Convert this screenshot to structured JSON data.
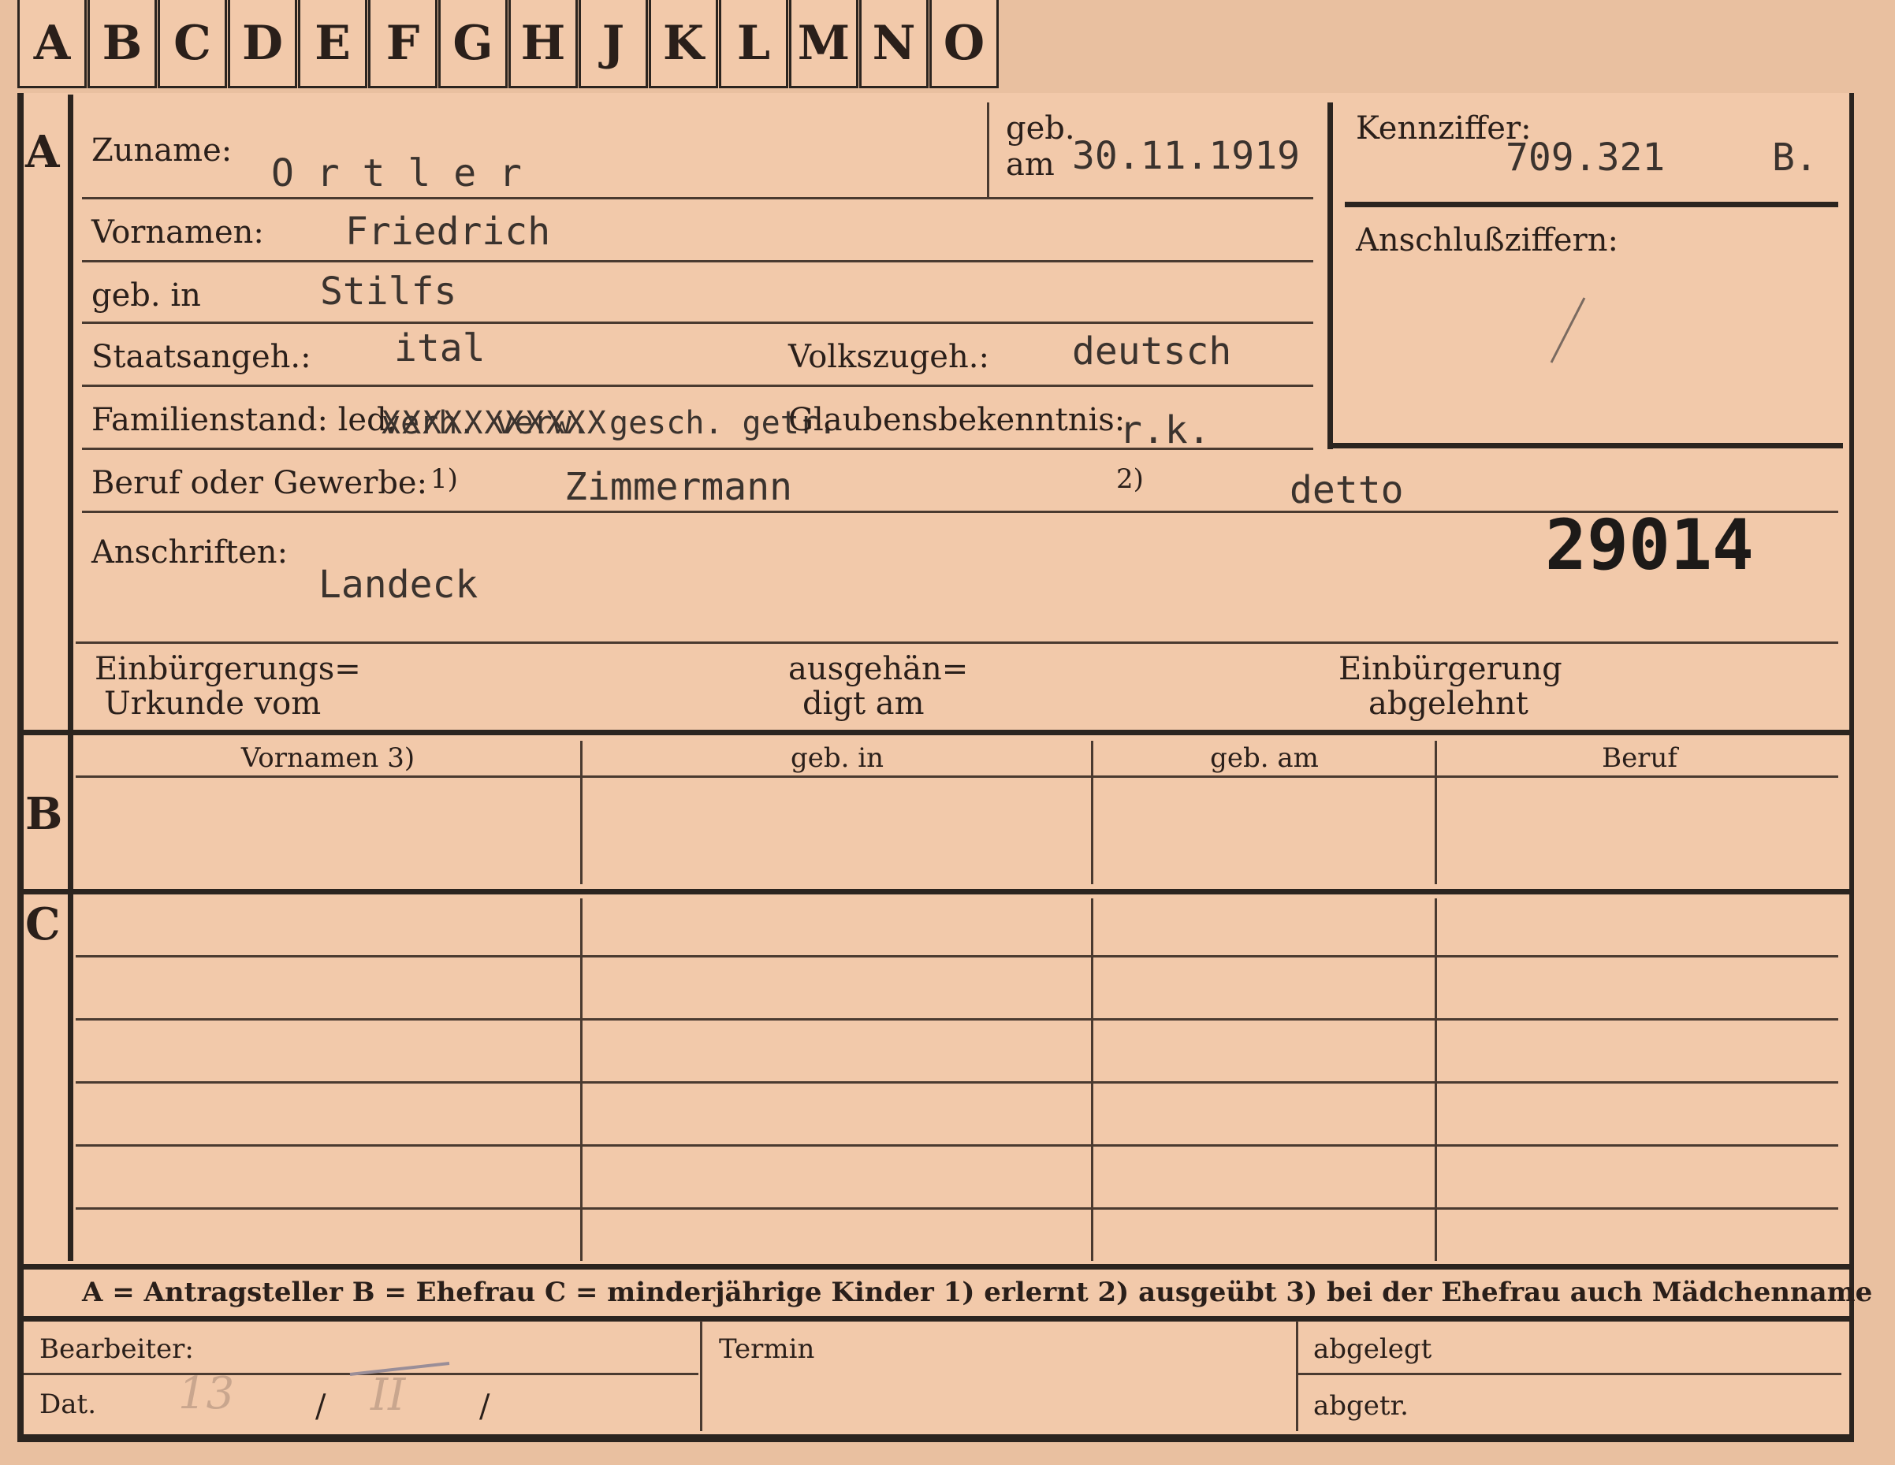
{
  "tabs": [
    "A",
    "B",
    "C",
    "D",
    "E",
    "F",
    "G",
    "H",
    "J",
    "K",
    "L",
    "M",
    "N",
    "O"
  ],
  "section_letters": {
    "a": "A",
    "b": "B",
    "c": "C"
  },
  "fields": {
    "zuname_label": "Zuname:",
    "zuname_value": "O r t l e r",
    "geb_label": "geb.",
    "am_label": "am",
    "geb_am_value": "30.11.1919",
    "kennziffer_label": "Kennziffer:",
    "kennziffer_value": "709.321",
    "kennziffer_suffix": "B.",
    "anschluss_label": "Anschlußziffern:",
    "vornamen_label": "Vornamen:",
    "vornamen_value": "Friedrich",
    "geb_in_label": "geb. in",
    "geb_in_value": "Stilfs",
    "staat_label": "Staatsangeh.:",
    "staat_value": "ital",
    "volk_label": "Volkszugeh.:",
    "volk_value": "deutsch",
    "familien_label": "Familienstand: led.",
    "familien_struck": "verh. verw. gesch. getr.",
    "familien_struck_x": "XXXXXXXXXXX",
    "glauben_label": "Glaubensbekenntnis:",
    "glauben_value": "r.k.",
    "beruf_label": "Beruf oder Gewerbe:",
    "beruf_fn1": "1)",
    "beruf_value1": "Zimmermann",
    "beruf_fn2": "2)",
    "beruf_value2": "detto",
    "anschriften_label": "Anschriften:",
    "anschriften_value": "Landeck",
    "stamp_number": "29014",
    "einb_line1": "Einbürgerungs=",
    "einb_line2": "Urkunde vom",
    "ausg_line1": "ausgehän=",
    "ausg_line2": "digt am",
    "abgelehnt_line1": "Einbürgerung",
    "abgelehnt_line2": "abgelehnt"
  },
  "table_headers": [
    "Vornamen 3)",
    "geb. in",
    "geb. am",
    "Beruf"
  ],
  "legend": "A = Antragsteller   B = Ehefrau   C = minderjährige Kinder   1) erlernt   2) ausgeübt   3) bei der Ehefrau auch Mädchenname",
  "footer": {
    "bearbeiter": "Bearbeiter:",
    "dat": "Dat.",
    "dat_day": "13",
    "dat_sep1": "/",
    "dat_month": "II",
    "dat_sep2": "/",
    "termin": "Termin",
    "abgelegt": "abgelegt",
    "abgetr": "abgetr."
  },
  "colors": {
    "card": "#f2c9aa",
    "ink": "#2a1f1a",
    "typewriter": "#3b332e"
  }
}
